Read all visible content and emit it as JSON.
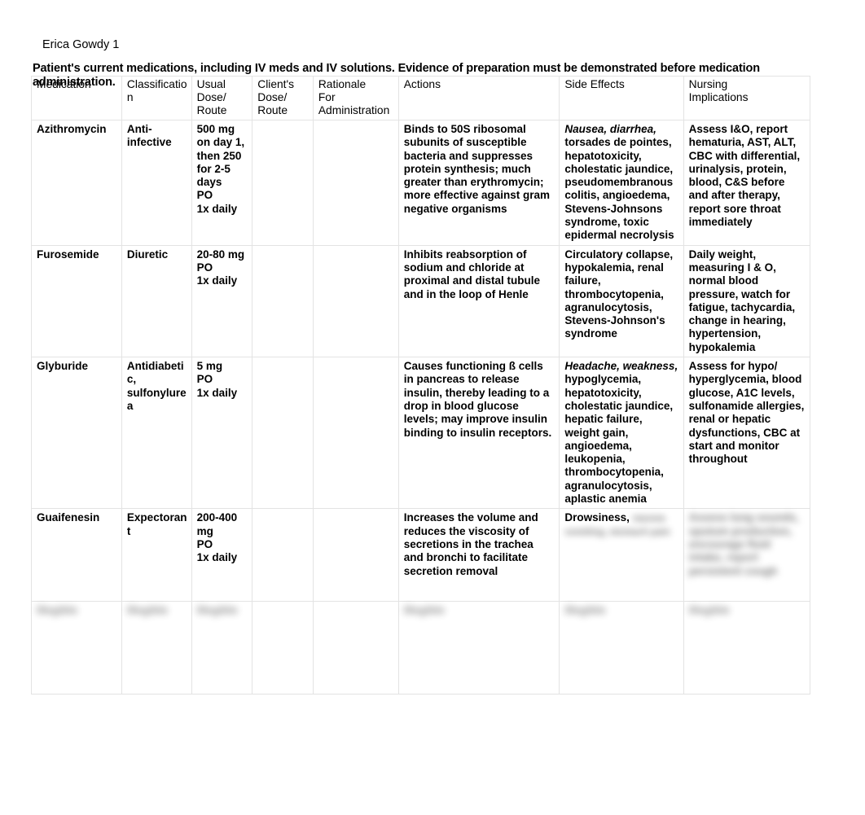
{
  "document": {
    "student_name": "Erica Gowdy 1",
    "title": "Patient's current medications, including IV meds and IV solutions. Evidence of preparation must be demonstrated before medication administration."
  },
  "table": {
    "columns": [
      "Medication",
      "Classification",
      "Usual Dose/ Route",
      "Client's Dose/ Route",
      "Rationale For Administration",
      "Actions",
      "Side Effects",
      "Nursing Implications"
    ],
    "column_lines": {
      "medication": [
        "Medication"
      ],
      "classification": [
        "Classification"
      ],
      "usual": [
        "Usual",
        "Dose/",
        "Route"
      ],
      "client": [
        "Client's",
        "Dose/",
        "Route"
      ],
      "rationale": [
        "Rationale",
        "For",
        "Administration"
      ],
      "actions": [
        "Actions"
      ],
      "side_effects": [
        "Side Effects"
      ],
      "nursing": [
        "Nursing",
        "Implications"
      ]
    },
    "rows": [
      {
        "medication": "Azithromycin",
        "classification": "Anti-infective",
        "usual_dose_route": [
          "500 mg",
          "on day 1,",
          "then 250",
          "for 2-5",
          "days",
          "PO",
          "1x daily"
        ],
        "client_dose_route": "",
        "rationale": "",
        "actions": "Binds to 50S ribosomal subunits of susceptible bacteria and suppresses protein synthesis; much greater than erythromycin; more effective against gram negative organisms",
        "side_effects_italic": "Nausea, diarrhea,",
        "side_effects_rest": "torsades de pointes, hepatotoxicity, cholestatic jaundice, pseudomembranous colitis, angioedema, Stevens-Johnsons syndrome, toxic epidermal necrolysis",
        "nursing": "Assess I&O, report hematuria, AST, ALT, CBC with differential, urinalysis, protein, blood, C&S before and after therapy, report sore throat immediately",
        "redacted": false
      },
      {
        "medication": "Furosemide",
        "classification": "Diuretic",
        "usual_dose_route": [
          "20-80 mg",
          "PO",
          "1x daily"
        ],
        "client_dose_route": "",
        "rationale": "",
        "actions": "Inhibits reabsorption of sodium and chloride at proximal and distal tubule and in the loop of Henle",
        "side_effects_italic": "",
        "side_effects_rest": "Circulatory collapse, hypokalemia, renal failure, thrombocytopenia, agranulocytosis, Stevens-Johnson's syndrome",
        "nursing": "Daily weight, measuring I & O, normal blood pressure, watch for fatigue, tachycardia, change in hearing, hypertension, hypokalemia",
        "redacted": false
      },
      {
        "medication": "Glyburide",
        "classification": "Antidiabetic, sulfonylurea",
        "usual_dose_route": [
          "5 mg",
          "PO",
          "1x daily"
        ],
        "client_dose_route": "",
        "rationale": "",
        "actions": "Causes functioning ß cells in pancreas to release insulin, thereby leading to a drop in blood glucose levels; may improve insulin binding to insulin receptors.",
        "side_effects_italic": "Headache, weakness,",
        "side_effects_rest": "hypoglycemia, hepatotoxicity, cholestatic jaundice, hepatic failure, weight gain, angioedema, leukopenia, thrombocytopenia, agranulocytosis, aplastic anemia",
        "nursing": "Assess for hypo/ hyperglycemia, blood glucose, A1C levels, sulfonamide allergies, renal or hepatic dysfunctions, CBC at start and monitor throughout",
        "redacted": false
      },
      {
        "medication": "Guaifenesin",
        "classification": "Expectorant",
        "usual_dose_route": [
          "200-400",
          "mg",
          "PO",
          "1x daily"
        ],
        "client_dose_route": "",
        "rationale": "",
        "actions": "Increases the volume and reduces the viscosity of secretions in the trachea and bronchi to facilitate secretion removal",
        "side_effects_italic": "",
        "side_effects_rest": "Drowsiness,",
        "side_effects_redacted": "nausea vomiting, stomach pain",
        "nursing_redacted": "Assess lung sounds, sputum production, encourage fluid intake, report persistent cough",
        "nursing": "",
        "redacted": "partial"
      },
      {
        "medication_redacted": "Illegible",
        "classification_redacted": "Illegible",
        "usual_dose_route_redacted": "Illegible",
        "client_dose_route": "",
        "rationale": "",
        "actions_redacted": "Illegible",
        "side_effects_redacted": "Illegible",
        "nursing_redacted": "Illegible",
        "redacted": true
      }
    ]
  }
}
